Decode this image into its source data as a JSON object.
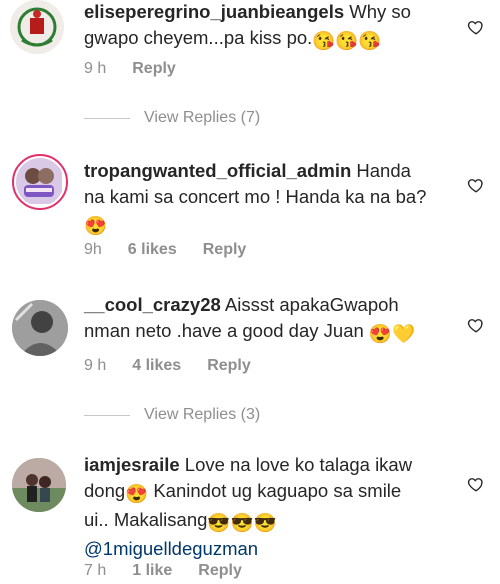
{
  "comments": [
    {
      "username": "eliseperegrino_juanbieangels",
      "text": " Why so gwapo cheyem...pa kiss po.",
      "emojis": "😘😘😘",
      "time": "9 h",
      "likes": "",
      "reply": "Reply"
    },
    {
      "username": "tropangwanted_official_admin",
      "text": " Handa na kami sa concert mo ! Handa ka na ba?",
      "emojis": "😍",
      "time": "9h",
      "likes": "6 likes",
      "reply": "Reply"
    },
    {
      "username": "__cool_crazy28",
      "text": " Aissst apakaGwapoh nman neto .have a good day Juan",
      "emojis": "😍💛",
      "time": "9 h",
      "likes": "4 likes",
      "reply": "Reply"
    },
    {
      "username": "iamjesraile",
      "text_part1": " Love na love ko talaga ikaw dong",
      "emoji1": "😍",
      "text_part2": " Kanindot ug kaguapo sa smile ui.. Makalisang",
      "emoji2": "😎😎😎",
      "mention": "@1miguelldeguzman",
      "time": "7 h",
      "likes": "1 like",
      "reply": "Reply"
    }
  ],
  "view_replies": [
    {
      "label": "View Replies (7)"
    },
    {
      "label": "View Replies (3)"
    }
  ],
  "colors": {
    "secondary_text": "#8e8e8e",
    "mention": "#00376b",
    "avatar_ring": "#e1306c"
  }
}
